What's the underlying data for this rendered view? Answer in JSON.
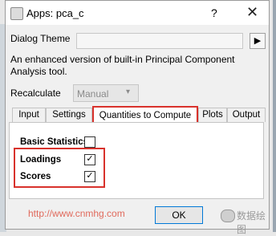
{
  "window": {
    "title": "Apps: pca_c",
    "help": "?",
    "close": "✕"
  },
  "dialog_theme": {
    "label": "Dialog Theme",
    "value": "",
    "arrow": "▶"
  },
  "description": "An enhanced version of built-in Principal Component Analysis tool.",
  "recalculate": {
    "label": "Recalculate",
    "value": "Manual",
    "chevron": "▾"
  },
  "tabs": [
    {
      "label": "Input"
    },
    {
      "label": "Settings"
    },
    {
      "label": "Quantities to Compute"
    },
    {
      "label": "Plots"
    },
    {
      "label": "Output"
    }
  ],
  "quantities": [
    {
      "label": "Basic Statistics",
      "checked": false,
      "mark": ""
    },
    {
      "label": "Loadings",
      "checked": true,
      "mark": "✓"
    },
    {
      "label": "Scores",
      "checked": true,
      "mark": "✓"
    }
  ],
  "watermark": "http://www.cnmhg.com",
  "ok_label": "OK",
  "brand_text": "数据绘图",
  "colors": {
    "highlight": "#d8322c",
    "focus": "#0078d7"
  }
}
